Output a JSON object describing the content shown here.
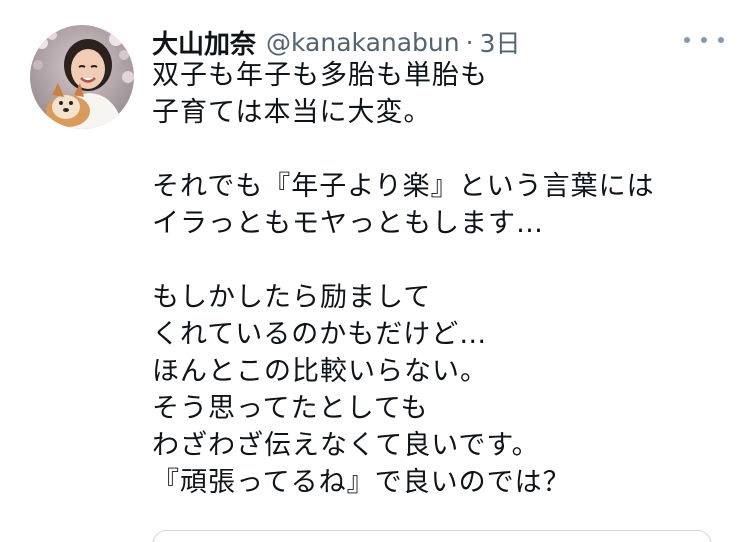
{
  "tweet": {
    "author": {
      "display_name": "大山加奈",
      "handle": "@kanakanabun",
      "separator": "·",
      "time": "3日"
    },
    "more_icon": "more-horizontal-icon",
    "lines": [
      "双子も年子も多胎も単胎も",
      "子育ては本当に大変。",
      "",
      "それでも『年子より楽』という言葉には",
      "イラっともモヤっともします…",
      "",
      "もしかしたら励まして",
      "くれているのかもだけど…",
      "ほんとこの比較いらない。",
      "そう思ってたとしても",
      "わざわざ伝えなくて良いです。",
      "『頑張ってるね』で良いのでは？"
    ]
  },
  "colors": {
    "name": "#0f1419",
    "secondary": "#536471",
    "border": "#cfd9de"
  }
}
